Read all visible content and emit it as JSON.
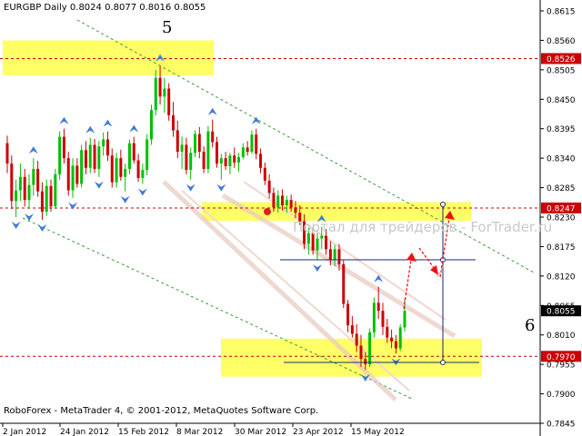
{
  "header": {
    "symbol": "EURGBP Daily",
    "quote": "0.8024 0.8077 0.8016 0.8055"
  },
  "footer": {
    "copyright": "RoboForex - MetaTrader 4, © 2001-2012, MetaQuotes Software Corp."
  },
  "watermark": "Портал для трейдеров - ForTrader.ru",
  "wave_labels": [
    "5",
    "6"
  ],
  "chart_data": {
    "type": "candlestick",
    "ylim": [
      0.7845,
      0.8615
    ],
    "y_ticks": [
      "0.8615",
      "0.8560",
      "0.8505",
      "0.8450",
      "0.8395",
      "0.8340",
      "0.8285",
      "0.8230",
      "0.8175",
      "0.8120",
      "0.8065",
      "0.8010",
      "0.7955",
      "0.7900",
      "0.7845"
    ],
    "x_ticks": [
      "2 Jan 2012",
      "24 Jan 2012",
      "15 Feb 2012",
      "8 Mar 2012",
      "30 Mar 2012",
      "23 Apr 2012",
      "15 May 2012"
    ],
    "last_price": "0.8055",
    "levels": [
      {
        "label": "0.8526",
        "value": 0.8526,
        "style": "dashed",
        "color": "#cc0000"
      },
      {
        "label": "0.8247",
        "value": 0.8247,
        "style": "dashed",
        "color": "#cc0000"
      },
      {
        "label": "0.7970",
        "value": 0.797,
        "style": "dashed",
        "color": "#cc0000"
      }
    ],
    "zones": [
      {
        "from": 0.8495,
        "to": 0.856
      },
      {
        "from": 0.8223,
        "to": 0.8258
      },
      {
        "from": 0.7932,
        "to": 0.8003
      }
    ],
    "colors": {
      "bull": "#00c000",
      "bear": "#cc0000",
      "zone": "#ffff66",
      "level_label": "#cc0000",
      "price_label": "#000000",
      "fractal": "#3e7bd6",
      "channel": "#3a9a3a",
      "trend": "#e8c8c0"
    },
    "candles": [
      [
        0.8368,
        0.8382,
        0.8312,
        0.833
      ],
      [
        0.833,
        0.8345,
        0.8245,
        0.826
      ],
      [
        0.826,
        0.83,
        0.823,
        0.828
      ],
      [
        0.828,
        0.833,
        0.826,
        0.8305
      ],
      [
        0.8305,
        0.832,
        0.825,
        0.8262
      ],
      [
        0.8262,
        0.831,
        0.8245,
        0.829
      ],
      [
        0.829,
        0.834,
        0.827,
        0.832
      ],
      [
        0.832,
        0.8335,
        0.8268,
        0.8278
      ],
      [
        0.8278,
        0.8295,
        0.8225,
        0.824
      ],
      [
        0.824,
        0.83,
        0.8232,
        0.8288
      ],
      [
        0.8288,
        0.83,
        0.824,
        0.825
      ],
      [
        0.825,
        0.832,
        0.8245,
        0.831
      ],
      [
        0.831,
        0.839,
        0.83,
        0.838
      ],
      [
        0.838,
        0.8395,
        0.833,
        0.834
      ],
      [
        0.834,
        0.8352,
        0.827,
        0.828
      ],
      [
        0.828,
        0.834,
        0.8266,
        0.8326
      ],
      [
        0.8326,
        0.834,
        0.8285,
        0.8292
      ],
      [
        0.8292,
        0.8365,
        0.8285,
        0.8355
      ],
      [
        0.8355,
        0.8372,
        0.831,
        0.8322
      ],
      [
        0.8322,
        0.8378,
        0.8312,
        0.8365
      ],
      [
        0.8365,
        0.8376,
        0.8312,
        0.832
      ],
      [
        0.832,
        0.8372,
        0.8305,
        0.8362
      ],
      [
        0.8362,
        0.8388,
        0.8345,
        0.8375
      ],
      [
        0.8375,
        0.839,
        0.8335,
        0.8345
      ],
      [
        0.8345,
        0.8358,
        0.8285,
        0.8295
      ],
      [
        0.8295,
        0.835,
        0.8285,
        0.834
      ],
      [
        0.834,
        0.8356,
        0.8298,
        0.8305
      ],
      [
        0.8305,
        0.833,
        0.8278,
        0.832
      ],
      [
        0.832,
        0.8375,
        0.831,
        0.8368
      ],
      [
        0.8368,
        0.838,
        0.833,
        0.8336
      ],
      [
        0.8336,
        0.8348,
        0.8296,
        0.8303
      ],
      [
        0.8303,
        0.833,
        0.8292,
        0.8318
      ],
      [
        0.8318,
        0.8385,
        0.8308,
        0.8375
      ],
      [
        0.8375,
        0.844,
        0.8365,
        0.843
      ],
      [
        0.843,
        0.8505,
        0.842,
        0.849
      ],
      [
        0.849,
        0.8512,
        0.844,
        0.8455
      ],
      [
        0.8455,
        0.849,
        0.8425,
        0.847
      ],
      [
        0.847,
        0.848,
        0.841,
        0.842
      ],
      [
        0.842,
        0.8445,
        0.838,
        0.8392
      ],
      [
        0.8392,
        0.841,
        0.834,
        0.8352
      ],
      [
        0.8352,
        0.838,
        0.832,
        0.8365
      ],
      [
        0.8365,
        0.8378,
        0.831,
        0.8318
      ],
      [
        0.8318,
        0.836,
        0.83,
        0.835
      ],
      [
        0.835,
        0.8392,
        0.8342,
        0.8385
      ],
      [
        0.8385,
        0.8398,
        0.834,
        0.8352
      ],
      [
        0.8352,
        0.8362,
        0.8312,
        0.832
      ],
      [
        0.832,
        0.84,
        0.8312,
        0.839
      ],
      [
        0.839,
        0.8412,
        0.836,
        0.837
      ],
      [
        0.837,
        0.838,
        0.8322,
        0.833
      ],
      [
        0.833,
        0.8348,
        0.83,
        0.834
      ],
      [
        0.834,
        0.8352,
        0.8318,
        0.8325
      ],
      [
        0.8325,
        0.835,
        0.831,
        0.8345
      ],
      [
        0.8345,
        0.836,
        0.8322,
        0.8332
      ],
      [
        0.8332,
        0.835,
        0.8315,
        0.8342
      ],
      [
        0.8342,
        0.8368,
        0.8338,
        0.836
      ],
      [
        0.836,
        0.8372,
        0.8345,
        0.8352
      ],
      [
        0.8352,
        0.8392,
        0.8348,
        0.8384
      ],
      [
        0.8384,
        0.8395,
        0.8338,
        0.8348
      ],
      [
        0.8348,
        0.8358,
        0.8312,
        0.8322
      ],
      [
        0.8322,
        0.8332,
        0.829,
        0.8298
      ],
      [
        0.8298,
        0.831,
        0.8265,
        0.8275
      ],
      [
        0.8275,
        0.8285,
        0.824,
        0.8248
      ],
      [
        0.8248,
        0.828,
        0.8238,
        0.827
      ],
      [
        0.827,
        0.8282,
        0.8242,
        0.8252
      ],
      [
        0.8252,
        0.827,
        0.8238,
        0.8262
      ],
      [
        0.8262,
        0.8272,
        0.824,
        0.8248
      ],
      [
        0.8248,
        0.826,
        0.8228,
        0.8238
      ],
      [
        0.8238,
        0.8252,
        0.8215,
        0.8222
      ],
      [
        0.8222,
        0.8235,
        0.817,
        0.818
      ],
      [
        0.818,
        0.821,
        0.816,
        0.82
      ],
      [
        0.82,
        0.821,
        0.816,
        0.8168
      ],
      [
        0.8168,
        0.82,
        0.815,
        0.819
      ],
      [
        0.819,
        0.8212,
        0.817,
        0.8195
      ],
      [
        0.8195,
        0.8208,
        0.816,
        0.817
      ],
      [
        0.817,
        0.8185,
        0.814,
        0.815
      ],
      [
        0.815,
        0.8178,
        0.8138,
        0.817
      ],
      [
        0.817,
        0.818,
        0.813,
        0.8142
      ],
      [
        0.8142,
        0.815,
        0.806,
        0.8068
      ],
      [
        0.8068,
        0.8075,
        0.8015,
        0.8028
      ],
      [
        0.8028,
        0.8045,
        0.8005,
        0.8012
      ],
      [
        0.8012,
        0.803,
        0.7978,
        0.799
      ],
      [
        0.799,
        0.801,
        0.795,
        0.7965
      ],
      [
        0.7965,
        0.7978,
        0.7945,
        0.7955
      ],
      [
        0.7955,
        0.8022,
        0.795,
        0.8015
      ],
      [
        0.8015,
        0.808,
        0.8005,
        0.807
      ],
      [
        0.807,
        0.81,
        0.804,
        0.8055
      ],
      [
        0.8055,
        0.807,
        0.801,
        0.8025
      ],
      [
        0.8025,
        0.804,
        0.7995,
        0.8005
      ],
      [
        0.8005,
        0.802,
        0.7985,
        0.7998
      ],
      [
        0.7998,
        0.801,
        0.7975,
        0.7985
      ],
      [
        0.7985,
        0.803,
        0.798,
        0.8024
      ],
      [
        0.8024,
        0.8077,
        0.8016,
        0.8055
      ]
    ]
  }
}
